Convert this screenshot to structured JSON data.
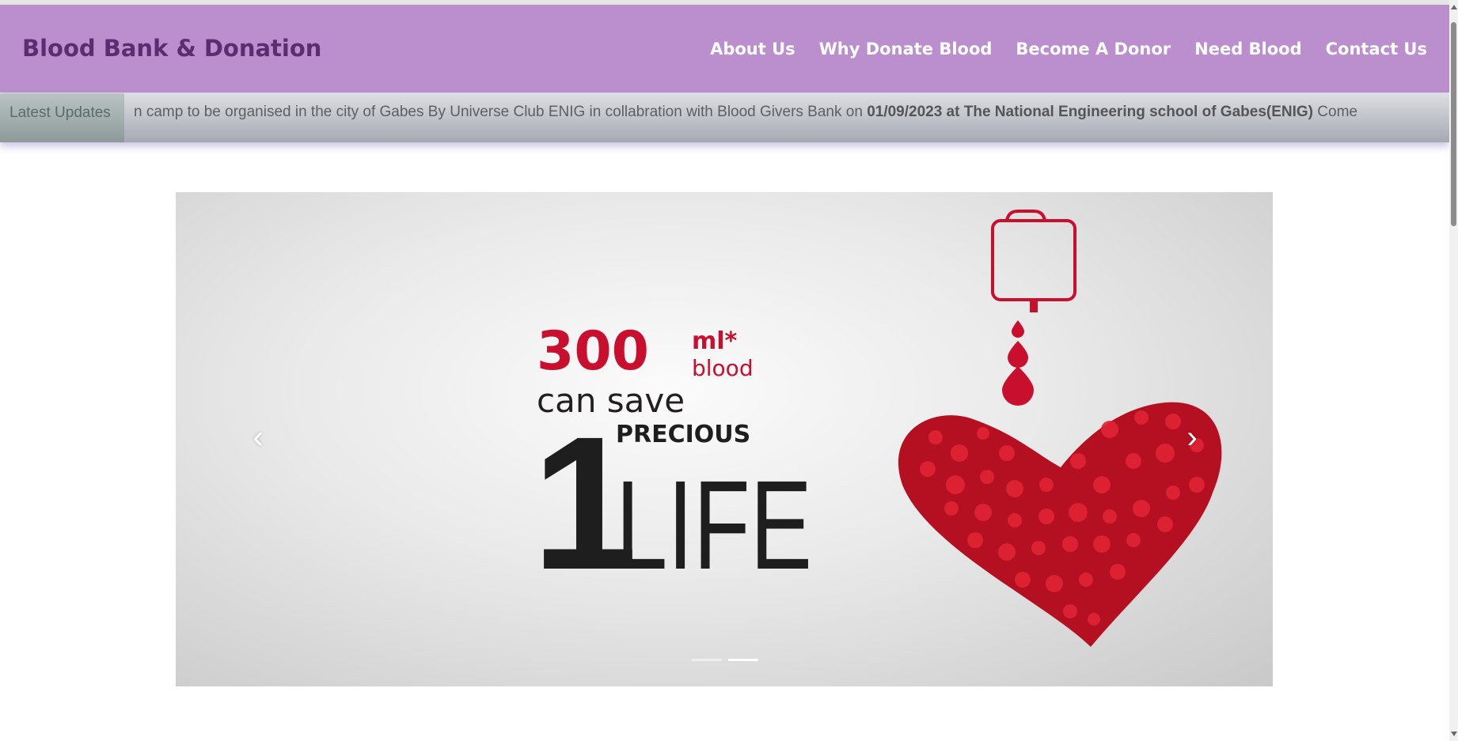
{
  "navbar": {
    "brand": "Blood Bank & Donation",
    "links": [
      "About Us",
      "Why Donate Blood",
      "Become A Donor",
      "Need Blood",
      "Contact Us"
    ]
  },
  "ticker": {
    "label": "Latest Updates",
    "text_before": "n camp to be organised in the city of Gabes By Universe Club ENIG in collabration with Blood Givers Bank on ",
    "text_bold": "01/09/2023 at The National Engineering school of Gabes(ENIG)",
    "text_after": " Come"
  },
  "carousel": {
    "slide": {
      "amount": "300",
      "unit": "ml*",
      "unit_sub": "blood",
      "line1": "can save",
      "number": "1",
      "word1": "PRECIOUS",
      "word2": "LIFE"
    },
    "prev_icon": "chevron-left-icon",
    "next_icon": "chevron-right-icon",
    "indicator_count": 2,
    "active_indicator": 2
  },
  "colors": {
    "navbar_bg": "#bb8fce",
    "brand": "#5b2c6f",
    "nav_link": "#ffffff",
    "accent_red": "#c8102e"
  }
}
